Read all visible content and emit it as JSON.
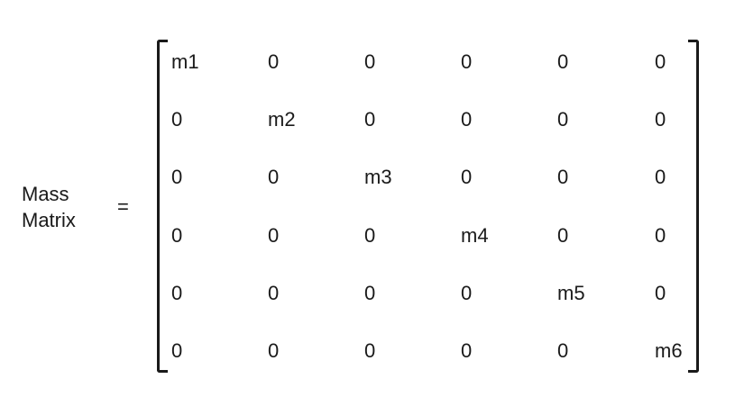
{
  "label": {
    "line1": "Mass",
    "line2": "Matrix"
  },
  "equals": "=",
  "matrix": [
    [
      "m1",
      "0",
      "0",
      "0",
      "0",
      "0"
    ],
    [
      "0",
      "m2",
      "0",
      "0",
      "0",
      "0"
    ],
    [
      "0",
      "0",
      "m3",
      "0",
      "0",
      "0"
    ],
    [
      "0",
      "0",
      "0",
      "m4",
      "0",
      "0"
    ],
    [
      "0",
      "0",
      "0",
      "0",
      "m5",
      "0"
    ],
    [
      "0",
      "0",
      "0",
      "0",
      "0",
      "m6"
    ]
  ]
}
